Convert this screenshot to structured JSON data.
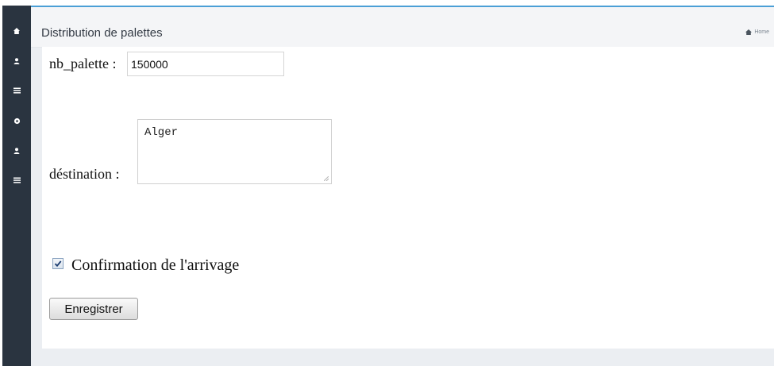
{
  "sidebar": {
    "icons": [
      "home-icon",
      "user-icon",
      "list-icon",
      "settings-icon",
      "user-icon",
      "list-icon"
    ]
  },
  "header": {
    "title": "Distribution de palettes",
    "breadcrumb": {
      "icon": "home-icon",
      "label": "Home"
    }
  },
  "form": {
    "nb_palette": {
      "label": "nb_palette :",
      "value": "150000"
    },
    "destination": {
      "label": "déstination :",
      "value": "Alger"
    },
    "confirmation": {
      "label": "Confirmation de l'arrivage",
      "checked": true
    },
    "submit": {
      "label": "Enregistrer"
    }
  },
  "colors": {
    "sidebar": "#2a3440",
    "accent": "#4b9fd6",
    "page_background": "#ebeef2"
  }
}
